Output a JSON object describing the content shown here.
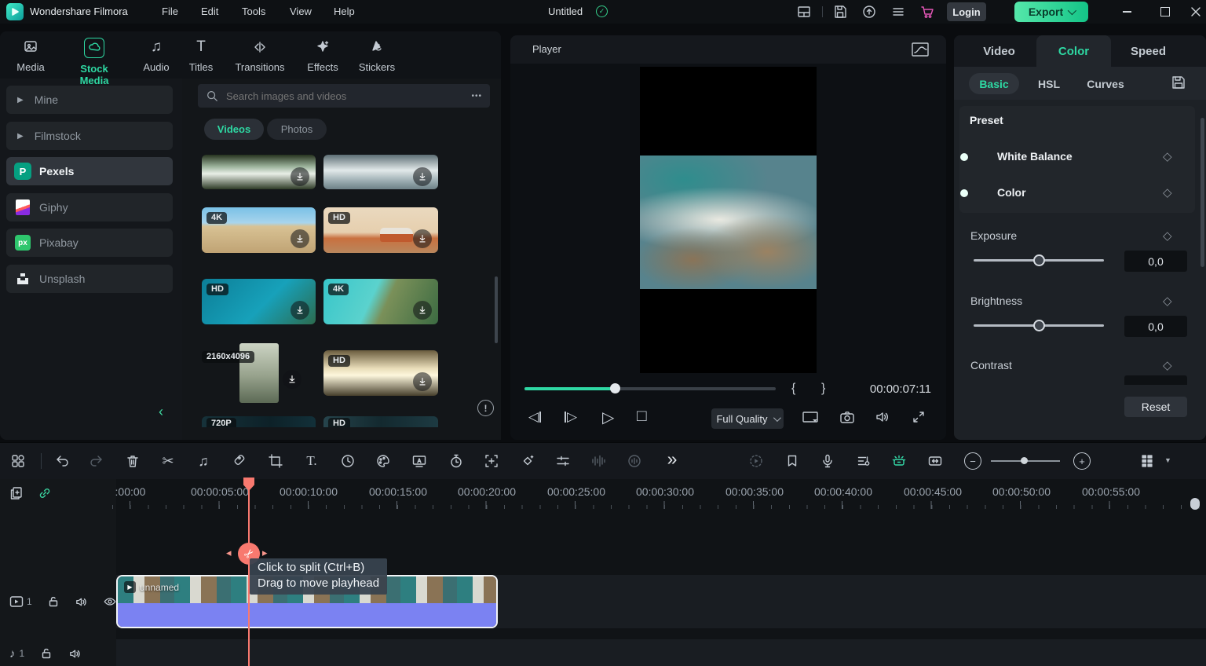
{
  "titlebar": {
    "app_name": "Wondershare Filmora",
    "menus": [
      "File",
      "Edit",
      "Tools",
      "View",
      "Help"
    ],
    "project_title": "Untitled",
    "login": "Login",
    "export": "Export"
  },
  "media_tabs": {
    "active": "Stock Media",
    "items": [
      {
        "label": "Media"
      },
      {
        "label": "Stock Media"
      },
      {
        "label": "Audio"
      },
      {
        "label": "Titles"
      },
      {
        "label": "Transitions"
      },
      {
        "label": "Effects"
      },
      {
        "label": "Stickers"
      }
    ]
  },
  "sources": {
    "active": "Pexels",
    "items": [
      {
        "label": "Mine"
      },
      {
        "label": "Filmstock"
      },
      {
        "label": "Pexels"
      },
      {
        "label": "Giphy"
      },
      {
        "label": "Pixabay"
      },
      {
        "label": "Unsplash"
      }
    ],
    "pixabay_glyph": "px",
    "pexels_glyph": "P"
  },
  "stock": {
    "search_placeholder": "Search images and videos",
    "tabs": [
      {
        "label": "Videos"
      },
      {
        "label": "Photos"
      }
    ],
    "active_tab": "Videos",
    "thumbnails": [
      {
        "name": "waterfall",
        "badge": ""
      },
      {
        "name": "ocean-waves",
        "badge": ""
      },
      {
        "name": "beach",
        "badge": "4K"
      },
      {
        "name": "camper-van",
        "badge": "HD"
      },
      {
        "name": "palm-water",
        "badge": "HD"
      },
      {
        "name": "tropical-coast",
        "badge": "4K"
      },
      {
        "name": "people-portrait",
        "badge": "2160x4096"
      },
      {
        "name": "sunset-grass",
        "badge": "HD"
      },
      {
        "name": "dark-sea",
        "badge": "720P"
      },
      {
        "name": "night-waves",
        "badge": "HD"
      }
    ]
  },
  "player": {
    "title": "Player",
    "timecode": "00:00:07:11",
    "quality": "Full Quality",
    "progress_percent": 36
  },
  "properties": {
    "active_tab": "Color",
    "tabs": [
      {
        "label": "Video"
      },
      {
        "label": "Color"
      },
      {
        "label": "Speed"
      }
    ],
    "active_subtab": "Basic",
    "subtabs": [
      {
        "label": "Basic"
      },
      {
        "label": "HSL"
      },
      {
        "label": "Curves"
      }
    ],
    "preset": {
      "title": "Preset",
      "toggles": [
        {
          "label": "White Balance",
          "on": true
        },
        {
          "label": "Color",
          "on": true
        }
      ]
    },
    "adjustments": [
      {
        "label": "Exposure",
        "value": "0,0"
      },
      {
        "label": "Brightness",
        "value": "0,0"
      },
      {
        "label": "Contrast",
        "value": ""
      }
    ],
    "reset": "Reset"
  },
  "timeline": {
    "ruler_labels": [
      ":00:00",
      "00:00:05:00",
      "00:00:10:00",
      "00:00:15:00",
      "00:00:20:00",
      "00:00:25:00",
      "00:00:30:00",
      "00:00:35:00",
      "00:00:40:00",
      "00:00:45:00",
      "00:00:50:00",
      "00:00:55:00"
    ],
    "tooltip": {
      "line1": "Click to split (Ctrl+B)",
      "line2": "Drag to move playhead"
    },
    "clip": {
      "name": "unnamed"
    },
    "tracks": [
      {
        "type": "video",
        "number": "1"
      },
      {
        "type": "audio",
        "number": "1"
      }
    ]
  },
  "icons": {
    "more_h": "•••",
    "chevron_double": "»",
    "triangle_right": "▶",
    "keyframe": "◇",
    "scissors": "✂",
    "notes": "♫",
    "note": "♪",
    "play": "▷",
    "tri_left": "◁",
    "stop": "□",
    "minus": "−",
    "plus": "+",
    "caret_down": "▼",
    "collapse": "‹",
    "check": "✓",
    "bang": "!",
    "brace_open": "{",
    "brace_close": "}",
    "text_tool": "T.",
    "arrow_left": "◂",
    "arrow_right": "▸",
    "letter_t": "T",
    "letter_a": "A"
  },
  "colors": {
    "accent": "#2ed9a3",
    "playhead": "#f8796f",
    "clip_audio": "#7b82f2",
    "export_start": "#55e7aa",
    "export_end": "#14c487",
    "cart_pink": "#e557b8"
  }
}
